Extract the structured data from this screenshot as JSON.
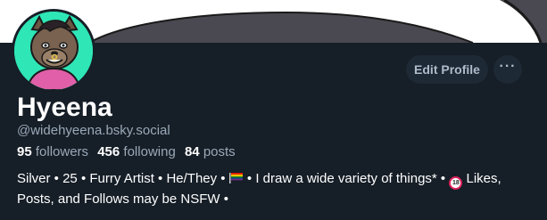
{
  "profile": {
    "display_name": "Hyeena",
    "handle": "@widehyeena.bsky.social",
    "avatar_icon": "hyena-avatar"
  },
  "actions": {
    "edit_profile_label": "Edit Profile",
    "more_label": "···"
  },
  "stats": {
    "followers_count": "95",
    "followers_label": "followers",
    "following_count": "456",
    "following_label": "following",
    "posts_count": "84",
    "posts_label": "posts"
  },
  "bio": {
    "part1": "Silver • 25 • Furry Artist • He/They • ",
    "flag_icon": "rainbow-flag-icon",
    "part2": " • I draw a wide variety of things* • ",
    "age_icon": "no-under-18-icon",
    "age_icon_text": "18",
    "part3": " Likes, Posts, and Follows may be NSFW •"
  },
  "colors": {
    "background": "#161e27",
    "banner": "#ffffff",
    "avatar_bg": "#2ee6b6",
    "button_bg": "#1e2936",
    "muted_text": "#9aa9b8"
  }
}
